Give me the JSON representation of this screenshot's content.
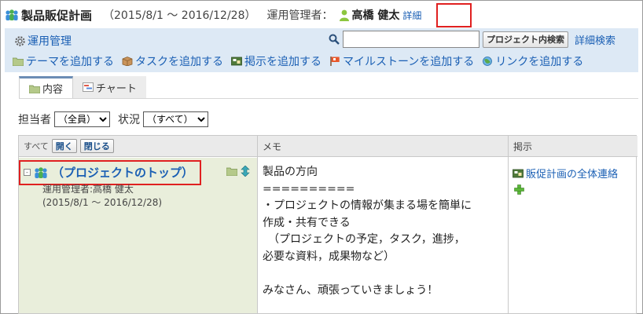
{
  "header": {
    "title": "製品販促計画",
    "period": "（2015/8/1 ～ 2016/12/28）",
    "manager_label": "運用管理者：",
    "manager_name": "高橋 健太",
    "detail_link": "詳細"
  },
  "toolbar": {
    "admin_link": "運用管理",
    "search_placeholder": "",
    "search_button": "プロジェクト内検索",
    "advanced_search": "詳細検索",
    "actions": [
      "テーマを追加する",
      "タスクを追加する",
      "掲示を追加する",
      "マイルストーンを追加する",
      "リンクを追加する"
    ]
  },
  "tabs": [
    {
      "label": "内容",
      "active": true
    },
    {
      "label": "チャート",
      "active": false
    }
  ],
  "filters": {
    "assignee_label": "担当者",
    "assignee_value": "（全員）",
    "status_label": "状況",
    "status_value": "（すべて）"
  },
  "table": {
    "all_label": "すべて",
    "open_button": "開く",
    "close_button": "閉じる",
    "memo_header": "メモ",
    "board_header": "掲示",
    "project_title": "（プロジェクトのトップ）",
    "project_manager": "運用管理者:高橋 健太",
    "project_period": "(2015/8/1 ～ 2016/12/28)",
    "memo_text": "製品の方向\n==========\n・プロジェクトの情報が集まる場を簡単に\n作成・共有できる\n　（プロジェクトの予定，タスク，進捗，\n必要な資料，成果物など）\n\nみなさん、頑張っていきましょう！",
    "board_link": "販促計画の全体連絡"
  },
  "colors": {
    "link": "#1a5fb4",
    "toolbar_bg": "#dde9f5",
    "highlight": "#e02020",
    "row_bg": "#e9eedb"
  }
}
